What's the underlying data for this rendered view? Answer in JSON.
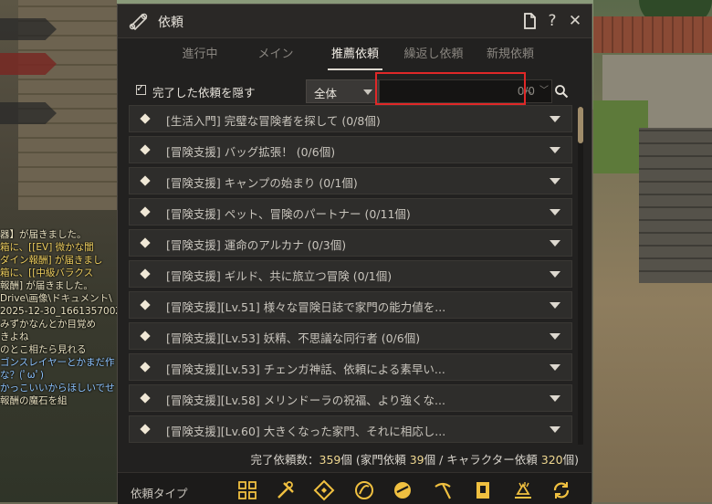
{
  "window": {
    "title": "依頼"
  },
  "tabs": [
    {
      "label": "進行中"
    },
    {
      "label": "メイン"
    },
    {
      "label": "推薦依頼",
      "active": true
    },
    {
      "label": "繰返し依頼"
    },
    {
      "label": "新規依頼"
    }
  ],
  "filter": {
    "hide_completed_label": "完了した依頼を隠す",
    "hide_completed_checked": true,
    "category_selected": "全体",
    "search_count": "0/0"
  },
  "quests": [
    {
      "text": "[生活入門] 完璧な冒険者を探して (0/8個)"
    },
    {
      "text": "[冒険支援] バッグ拡張！ (0/6個)"
    },
    {
      "text": "[冒険支援] キャンプの始まり (0/1個)"
    },
    {
      "text": "[冒険支援] ペット、冒険のパートナー (0/11個)"
    },
    {
      "text": "[冒険支援] 運命のアルカナ (0/3個)"
    },
    {
      "text": "[冒険支援] ギルド、共に旅立つ冒険 (0/1個)"
    },
    {
      "text": "[冒険支援][Lv.51] 様々な冒険日誌で家門の能力値を..."
    },
    {
      "text": "[冒険支援][Lv.53] 妖精、不思議な同行者 (0/6個)"
    },
    {
      "text": "[冒険支援][Lv.53] チェンガ神話、依頼による素早い..."
    },
    {
      "text": "[冒険支援][Lv.58] メリンドーラの祝福、より強くな..."
    },
    {
      "text": "[冒険支援][Lv.60] 大きくなった家門、それに相応し..."
    }
  ],
  "summary": {
    "prefix": "完了依頼数：",
    "total": "359",
    "mid1": "個 (家門依頼 ",
    "family": "39",
    "mid2": "個 / キャラクター依頼 ",
    "character": "320",
    "suffix": "個)"
  },
  "type_bar": {
    "label": "依頼タイプ",
    "icons": [
      "grid-icon",
      "tools-icon",
      "diamond-quest-icon",
      "swirl-icon",
      "combat-icon",
      "pickaxe-icon",
      "book-icon",
      "trade-icon",
      "refresh-icon"
    ]
  },
  "chat": {
    "lines": [
      {
        "text": "器】が届きました。",
        "color": "white"
      },
      {
        "text": "箱に、[[EV] 微かな闇",
        "color": "yellow"
      },
      {
        "text": "ダイン報酬] が届きまし",
        "color": "yellow"
      },
      {
        "text": "箱に、[[中級バラクス",
        "color": "yellow"
      },
      {
        "text": "報酬] が届きました。",
        "color": "white"
      },
      {
        "text": "Drive\\画像\\ドキュメント\\",
        "color": "white"
      },
      {
        "text": "2025-12-30_166135700Z.JPG",
        "color": "white"
      },
      {
        "text": "みずかなんとか目覚め",
        "color": "white"
      },
      {
        "text": "きよね",
        "color": "white"
      },
      {
        "text": "のとこ相たら見れる",
        "color": "white"
      },
      {
        "text": "ゴンスレイヤーとかまだ作",
        "color": "blue"
      },
      {
        "text": "な？(ﾟωﾟ)",
        "color": "blue"
      },
      {
        "text": "かっこいいからほしいでせ",
        "color": "blue"
      },
      {
        "text": "報酬の魔石を組",
        "color": "white"
      }
    ]
  },
  "colors": {
    "highlight_box": "#e02828",
    "summary_number": "#f0d890",
    "scroll_thumb": "#a08c6a"
  }
}
